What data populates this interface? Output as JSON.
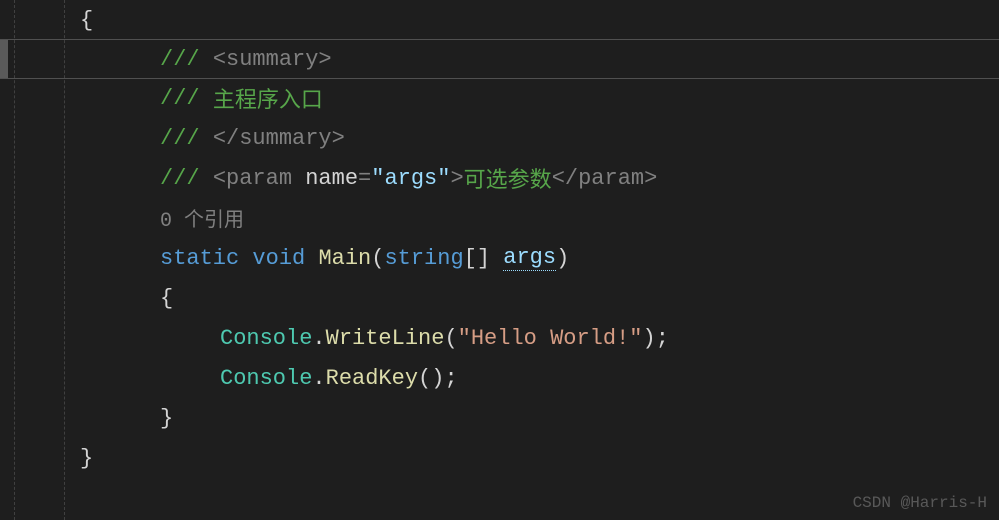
{
  "code": {
    "brace_open": "{",
    "brace_close": "}",
    "doc": {
      "slashes": "/// ",
      "summary_open": "<summary>",
      "summary_text": "主程序入口",
      "summary_close": "</summary>",
      "param_open": "<param ",
      "param_attr_name": "name",
      "param_attr_eq": "=",
      "param_attr_value": "\"args\"",
      "param_close_bracket": ">",
      "param_text": "可选参数",
      "param_close": "</param>"
    },
    "codelens": "0 个引用",
    "method": {
      "static": "static",
      "void": "void",
      "name": "Main",
      "paren_open": "(",
      "param_type": "string",
      "brackets": "[]",
      "param_name": "args",
      "paren_close": ")"
    },
    "body": {
      "console": "Console",
      "dot": ".",
      "writeline": "WriteLine",
      "readkey": "ReadKey",
      "paren_open": "(",
      "paren_close": ")",
      "string_hello": "\"Hello World!\"",
      "semicolon": ";"
    }
  },
  "watermark": "CSDN @Harris-H"
}
